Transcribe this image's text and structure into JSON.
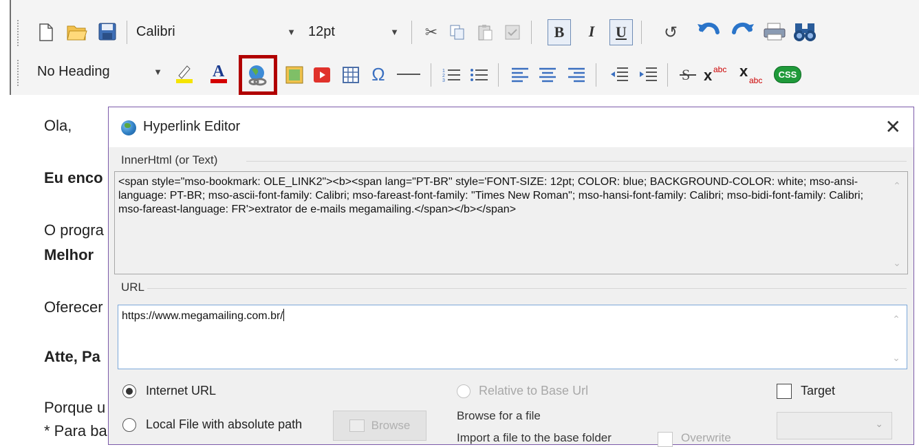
{
  "toolbar1": {
    "font_name": "Calibri",
    "font_size": "12pt",
    "bold": "B",
    "italic": "I",
    "underline": "U"
  },
  "toolbar2": {
    "heading": "No Heading",
    "css_badge": "CSS",
    "omega": "Ω"
  },
  "editor": {
    "line1": "Ola,",
    "line2": "Eu enco",
    "line3a": "O progra",
    "line3b": "Melhor",
    "line4": "Oferecer",
    "line5": "Atte, Pa",
    "line6a": "Porque u",
    "line6b": "* Para ba"
  },
  "dialog": {
    "title": "Hyperlink Editor",
    "inner_label": "InnerHtml (or Text)",
    "inner_value": "<span style=\"mso-bookmark: OLE_LINK2\"><b><span lang=\"PT-BR\" style='FONT-SIZE: 12pt; COLOR: blue; BACKGROUND-COLOR: white; mso-ansi-language: PT-BR; mso-ascii-font-family: Calibri; mso-fareast-font-family: \"Times New Roman\"; mso-hansi-font-family: Calibri; mso-bidi-font-family: Calibri; mso-fareast-language: FR'>extrator de e-mails megamailing.</span></b></span>",
    "url_label": "URL",
    "url_value": "https://www.megamailing.com.br/",
    "opt_internet": "Internet URL",
    "opt_relative": "Relative to Base Url",
    "opt_local": "Local File with absolute path",
    "browse": "Browse",
    "browse_for_file": "Browse for a file",
    "import_base": "Import a file to the base folder",
    "overwrite": "Overwrite",
    "target": "Target"
  }
}
